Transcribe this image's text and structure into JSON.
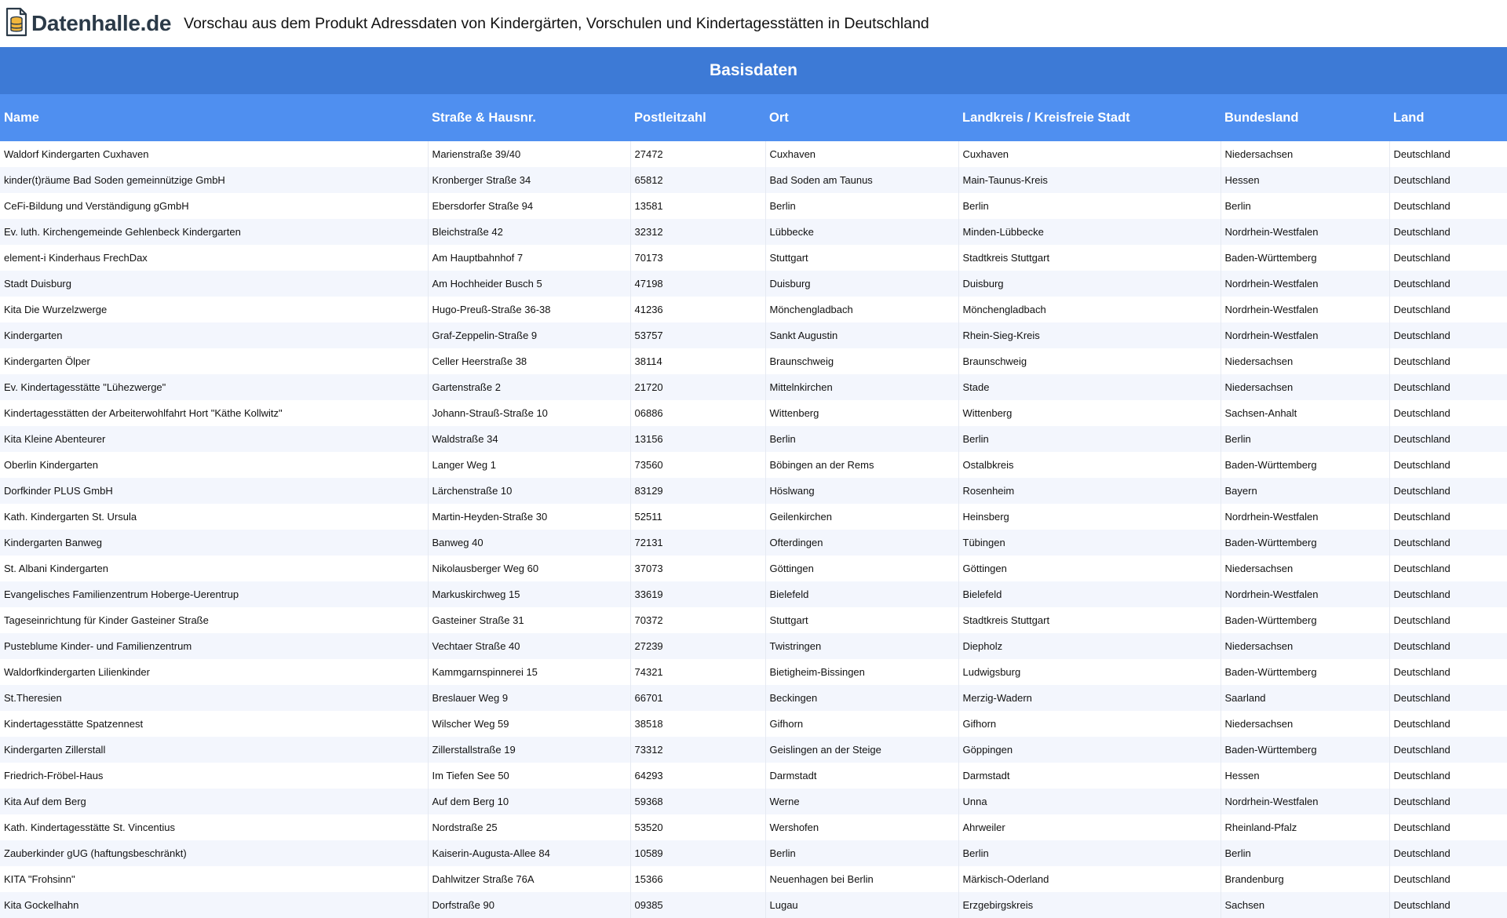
{
  "brand": {
    "name": "Datenhalle.de",
    "logo_icon": "database-document-icon"
  },
  "page_title": "Vorschau aus dem Produkt Adressdaten von Kindergärten, Vorschulen und Kindertagesstätten in Deutschland",
  "section_title": "Basisdaten",
  "colors": {
    "band": "#3d7ad6",
    "header": "#4f8ff0",
    "stripe": "#f3f6fd"
  },
  "columns": [
    "Name",
    "Straße & Hausnr.",
    "Postleitzahl",
    "Ort",
    "Landkreis / Kreisfreie Stadt",
    "Bundesland",
    "Land"
  ],
  "rows": [
    [
      "Waldorf Kindergarten Cuxhaven",
      "Marienstraße 39/40",
      "27472",
      "Cuxhaven",
      "Cuxhaven",
      "Niedersachsen",
      "Deutschland"
    ],
    [
      "kinder(t)räume Bad Soden gemeinnützige GmbH",
      "Kronberger Straße 34",
      "65812",
      "Bad Soden am Taunus",
      "Main-Taunus-Kreis",
      "Hessen",
      "Deutschland"
    ],
    [
      "CeFi-Bildung und Verständigung gGmbH",
      "Ebersdorfer Straße 94",
      "13581",
      "Berlin",
      "Berlin",
      "Berlin",
      "Deutschland"
    ],
    [
      "Ev. luth. Kirchengemeinde Gehlenbeck Kindergarten",
      "Bleichstraße 42",
      "32312",
      "Lübbecke",
      "Minden-Lübbecke",
      "Nordrhein-Westfalen",
      "Deutschland"
    ],
    [
      "element-i Kinderhaus FrechDax",
      "Am Hauptbahnhof 7",
      "70173",
      "Stuttgart",
      "Stadtkreis Stuttgart",
      "Baden-Württemberg",
      "Deutschland"
    ],
    [
      "Stadt Duisburg",
      "Am Hochheider Busch 5",
      "47198",
      "Duisburg",
      "Duisburg",
      "Nordrhein-Westfalen",
      "Deutschland"
    ],
    [
      "Kita Die Wurzelzwerge",
      "Hugo-Preuß-Straße 36-38",
      "41236",
      "Mönchengladbach",
      "Mönchengladbach",
      "Nordrhein-Westfalen",
      "Deutschland"
    ],
    [
      "Kindergarten",
      "Graf-Zeppelin-Straße 9",
      "53757",
      "Sankt Augustin",
      "Rhein-Sieg-Kreis",
      "Nordrhein-Westfalen",
      "Deutschland"
    ],
    [
      "Kindergarten Ölper",
      "Celler Heerstraße 38",
      "38114",
      "Braunschweig",
      "Braunschweig",
      "Niedersachsen",
      "Deutschland"
    ],
    [
      "Ev. Kindertagesstätte \"Lühezwerge\"",
      "Gartenstraße 2",
      "21720",
      "Mittelnkirchen",
      "Stade",
      "Niedersachsen",
      "Deutschland"
    ],
    [
      "Kindertagesstätten der Arbeiterwohlfahrt Hort \"Käthe Kollwitz\"",
      "Johann-Strauß-Straße 10",
      "06886",
      "Wittenberg",
      "Wittenberg",
      "Sachsen-Anhalt",
      "Deutschland"
    ],
    [
      "Kita Kleine Abenteurer",
      "Waldstraße 34",
      "13156",
      "Berlin",
      "Berlin",
      "Berlin",
      "Deutschland"
    ],
    [
      "Oberlin Kindergarten",
      "Langer Weg 1",
      "73560",
      "Böbingen an der Rems",
      "Ostalbkreis",
      "Baden-Württemberg",
      "Deutschland"
    ],
    [
      "Dorfkinder PLUS GmbH",
      "Lärchenstraße 10",
      "83129",
      "Höslwang",
      "Rosenheim",
      "Bayern",
      "Deutschland"
    ],
    [
      "Kath. Kindergarten St. Ursula",
      "Martin-Heyden-Straße 30",
      "52511",
      "Geilenkirchen",
      "Heinsberg",
      "Nordrhein-Westfalen",
      "Deutschland"
    ],
    [
      "Kindergarten Banweg",
      "Banweg 40",
      "72131",
      "Ofterdingen",
      "Tübingen",
      "Baden-Württemberg",
      "Deutschland"
    ],
    [
      "St. Albani Kindergarten",
      "Nikolausberger Weg 60",
      "37073",
      "Göttingen",
      "Göttingen",
      "Niedersachsen",
      "Deutschland"
    ],
    [
      "Evangelisches Familienzentrum Hoberge-Uerentrup",
      "Markuskirchweg 15",
      "33619",
      "Bielefeld",
      "Bielefeld",
      "Nordrhein-Westfalen",
      "Deutschland"
    ],
    [
      "Tageseinrichtung für Kinder Gasteiner Straße",
      "Gasteiner Straße 31",
      "70372",
      "Stuttgart",
      "Stadtkreis Stuttgart",
      "Baden-Württemberg",
      "Deutschland"
    ],
    [
      "Pusteblume Kinder- und Familienzentrum",
      "Vechtaer Straße 40",
      "27239",
      "Twistringen",
      "Diepholz",
      "Niedersachsen",
      "Deutschland"
    ],
    [
      "Waldorfkindergarten Lilienkinder",
      "Kammgarnspinnerei 15",
      "74321",
      "Bietigheim-Bissingen",
      "Ludwigsburg",
      "Baden-Württemberg",
      "Deutschland"
    ],
    [
      "St.Theresien",
      "Breslauer Weg 9",
      "66701",
      "Beckingen",
      "Merzig-Wadern",
      "Saarland",
      "Deutschland"
    ],
    [
      "Kindertagesstätte Spatzennest",
      "Wilscher Weg 59",
      "38518",
      "Gifhorn",
      "Gifhorn",
      "Niedersachsen",
      "Deutschland"
    ],
    [
      "Kindergarten Zillerstall",
      "Zillerstallstraße 19",
      "73312",
      "Geislingen an der Steige",
      "Göppingen",
      "Baden-Württemberg",
      "Deutschland"
    ],
    [
      "Friedrich-Fröbel-Haus",
      "Im Tiefen See 50",
      "64293",
      "Darmstadt",
      "Darmstadt",
      "Hessen",
      "Deutschland"
    ],
    [
      "Kita Auf dem Berg",
      "Auf dem Berg 10",
      "59368",
      "Werne",
      "Unna",
      "Nordrhein-Westfalen",
      "Deutschland"
    ],
    [
      "Kath. Kindertagesstätte St. Vincentius",
      "Nordstraße 25",
      "53520",
      "Wershofen",
      "Ahrweiler",
      "Rheinland-Pfalz",
      "Deutschland"
    ],
    [
      "Zauberkinder gUG (haftungsbeschränkt)",
      "Kaiserin-Augusta-Allee 84",
      "10589",
      "Berlin",
      "Berlin",
      "Berlin",
      "Deutschland"
    ],
    [
      "KITA \"Frohsinn\"",
      "Dahlwitzer Straße 76A",
      "15366",
      "Neuenhagen bei Berlin",
      "Märkisch-Oderland",
      "Brandenburg",
      "Deutschland"
    ],
    [
      "Kita Gockelhahn",
      "Dorfstraße 90",
      "09385",
      "Lugau",
      "Erzgebirgskreis",
      "Sachsen",
      "Deutschland"
    ]
  ]
}
